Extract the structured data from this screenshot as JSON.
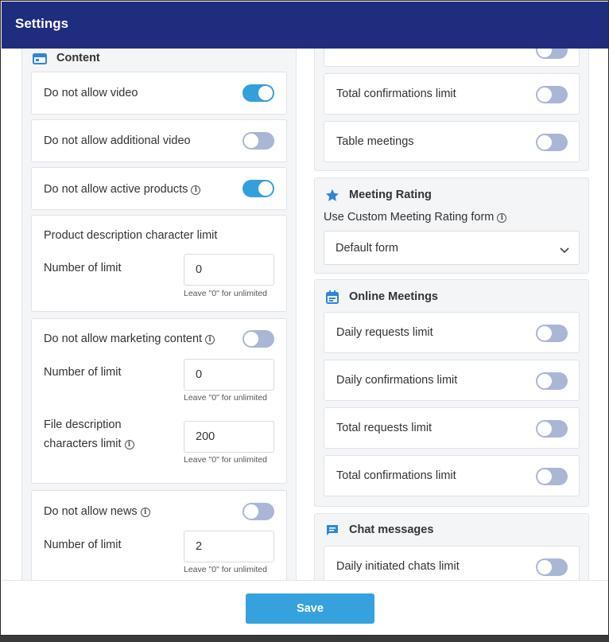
{
  "header": {
    "title": "Settings"
  },
  "left": {
    "content_title": "Content",
    "video_label": "Do not allow video",
    "additional_video_label": "Do not allow additional video",
    "active_products_label": "Do not allow active products",
    "product_desc_title": "Product description character limit",
    "number_of_limit_label": "Number of limit",
    "product_desc_value": "0",
    "leave_hint": "Leave \"0\" for unlimited",
    "marketing_label": "Do not allow marketing content",
    "marketing_limit_value": "0",
    "file_desc_line1": "File description",
    "file_desc_line2": "characters limit",
    "file_desc_value": "200",
    "news_label": "Do not allow news",
    "news_limit_value": "2"
  },
  "right": {
    "total_confirmations_label": "Total confirmations limit",
    "table_meetings_label": "Table meetings",
    "meeting_rating_title": "Meeting Rating",
    "custom_rating_label": "Use Custom Meeting Rating form",
    "rating_select_value": "Default form",
    "online_meetings_title": "Online Meetings",
    "daily_requests_label": "Daily requests limit",
    "daily_confirmations_label": "Daily confirmations limit",
    "total_requests_label": "Total requests limit",
    "online_total_confirmations_label": "Total confirmations limit",
    "chat_messages_title": "Chat messages",
    "daily_chats_label": "Daily initiated chats limit"
  },
  "toggles": {
    "video": "on",
    "additional_video": "off",
    "active_products": "on",
    "marketing": "off",
    "news": "off",
    "top_partial": "off",
    "total_confirmations": "off",
    "table_meetings": "off",
    "daily_requests": "off",
    "daily_confirmations": "off",
    "total_requests": "off",
    "online_total_confirmations": "off",
    "daily_chats": "off"
  },
  "footer": {
    "save_label": "Save"
  },
  "colors": {
    "header": "#1f2d7e",
    "accent": "#34a0db",
    "toggle_off": "#a9b6d6"
  }
}
